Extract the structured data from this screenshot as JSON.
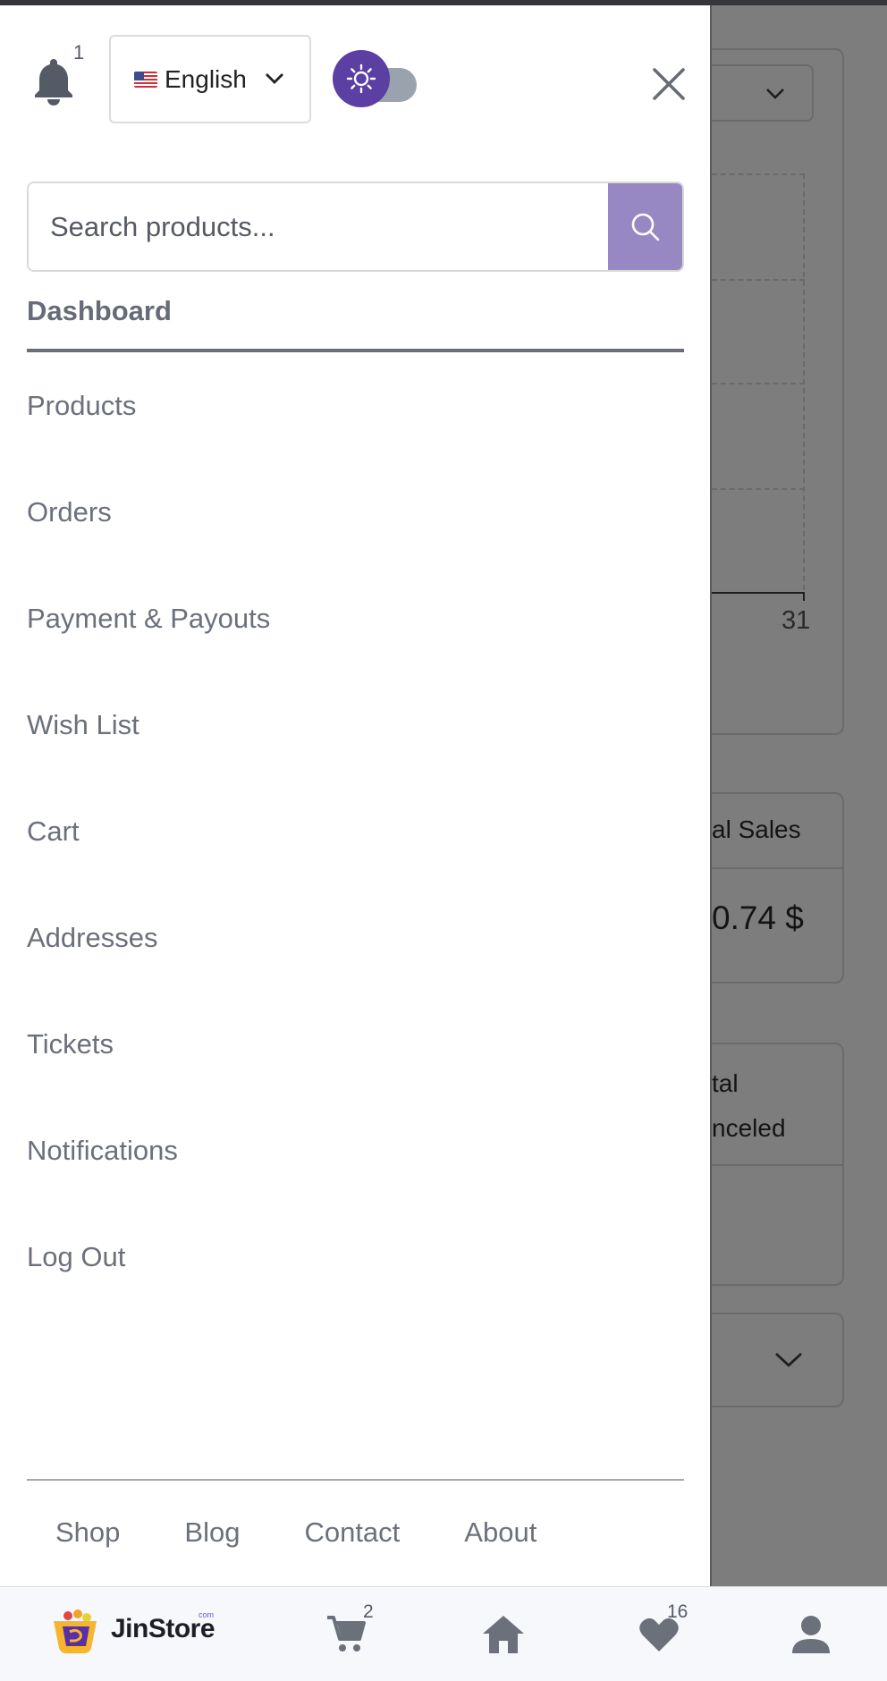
{
  "header": {
    "notification_count": "1",
    "language": {
      "label": "English",
      "flag": "us-flag"
    },
    "theme_toggle": {
      "icon": "sun-icon",
      "state": "light"
    }
  },
  "search": {
    "placeholder": "Search products..."
  },
  "nav": {
    "active": "Dashboard",
    "items": [
      {
        "label": "Products"
      },
      {
        "label": "Orders"
      },
      {
        "label": "Payment & Payouts"
      },
      {
        "label": "Wish List"
      },
      {
        "label": "Cart"
      },
      {
        "label": "Addresses"
      },
      {
        "label": "Tickets"
      },
      {
        "label": "Notifications"
      },
      {
        "label": "Log Out"
      }
    ]
  },
  "footer_links": [
    "Shop",
    "Blog",
    "Contact",
    "About"
  ],
  "background": {
    "chart_tick": "31",
    "card1_header": "al Sales",
    "card1_value": "0.74 $",
    "card2_line1": "tal",
    "card2_line2": "nceled"
  },
  "bottom_nav": {
    "brand": "JinStore",
    "brand_suffix": "com",
    "cart_count": "2",
    "wishlist_count": "16"
  },
  "colors": {
    "accent": "#5b3fa3",
    "search_button": "#9788c4",
    "overlay": "#7d7d7d"
  }
}
